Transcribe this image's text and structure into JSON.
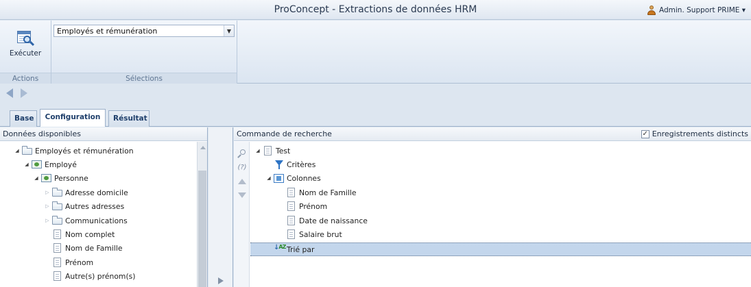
{
  "titlebar": {
    "title": "ProConcept - Extractions de données HRM",
    "user": "Admin. Support PRIME ▾"
  },
  "ribbon": {
    "execute_label": "Exécuter",
    "actions_group": "Actions",
    "selections_group": "Sélections",
    "selection_value": "Employés et rémunération"
  },
  "tabs": [
    {
      "label": "Base"
    },
    {
      "label": "Configuration",
      "active": true
    },
    {
      "label": "Résultat"
    }
  ],
  "left_panel": {
    "header": "Données disponibles",
    "tree": [
      {
        "label": "Employés et rémunération",
        "icon": "folder-icon",
        "expander": "expanded"
      },
      {
        "label": "Employé",
        "icon": "entity-icon",
        "expander": "expanded"
      },
      {
        "label": "Personne",
        "icon": "entity-icon",
        "expander": "expanded"
      },
      {
        "label": "Adresse domicile",
        "icon": "folder-icon",
        "expander": "collapsed"
      },
      {
        "label": "Autres adresses",
        "icon": "folder-icon",
        "expander": "collapsed"
      },
      {
        "label": "Communications",
        "icon": "folder-icon",
        "expander": "collapsed"
      },
      {
        "label": "Nom complet",
        "icon": "document-icon"
      },
      {
        "label": "Nom de Famille",
        "icon": "document-icon"
      },
      {
        "label": "Prénom",
        "icon": "document-icon"
      },
      {
        "label": "Autre(s) prénom(s)",
        "icon": "document-icon"
      }
    ]
  },
  "right_panel": {
    "header": "Commande de recherche",
    "distinct_label": "Enregistrements distincts",
    "distinct_checked": true,
    "help_text": "(?)",
    "tree": [
      {
        "label": "Test",
        "icon": "query-icon",
        "expander": "expanded"
      },
      {
        "label": "Critères",
        "icon": "filter-icon"
      },
      {
        "label": "Colonnes",
        "icon": "columns-icon",
        "expander": "expanded"
      },
      {
        "label": "Nom de Famille",
        "icon": "document-icon"
      },
      {
        "label": "Prénom",
        "icon": "document-icon"
      },
      {
        "label": "Date de naissance",
        "icon": "document-icon"
      },
      {
        "label": "Salaire brut",
        "icon": "document-icon"
      },
      {
        "label": "Trié par",
        "icon": "sort-icon",
        "selected": true
      }
    ]
  },
  "colors": {
    "accent": "#1f3f6b",
    "selection": "#c3d6ec",
    "ribbon": "#dbe5f1"
  }
}
